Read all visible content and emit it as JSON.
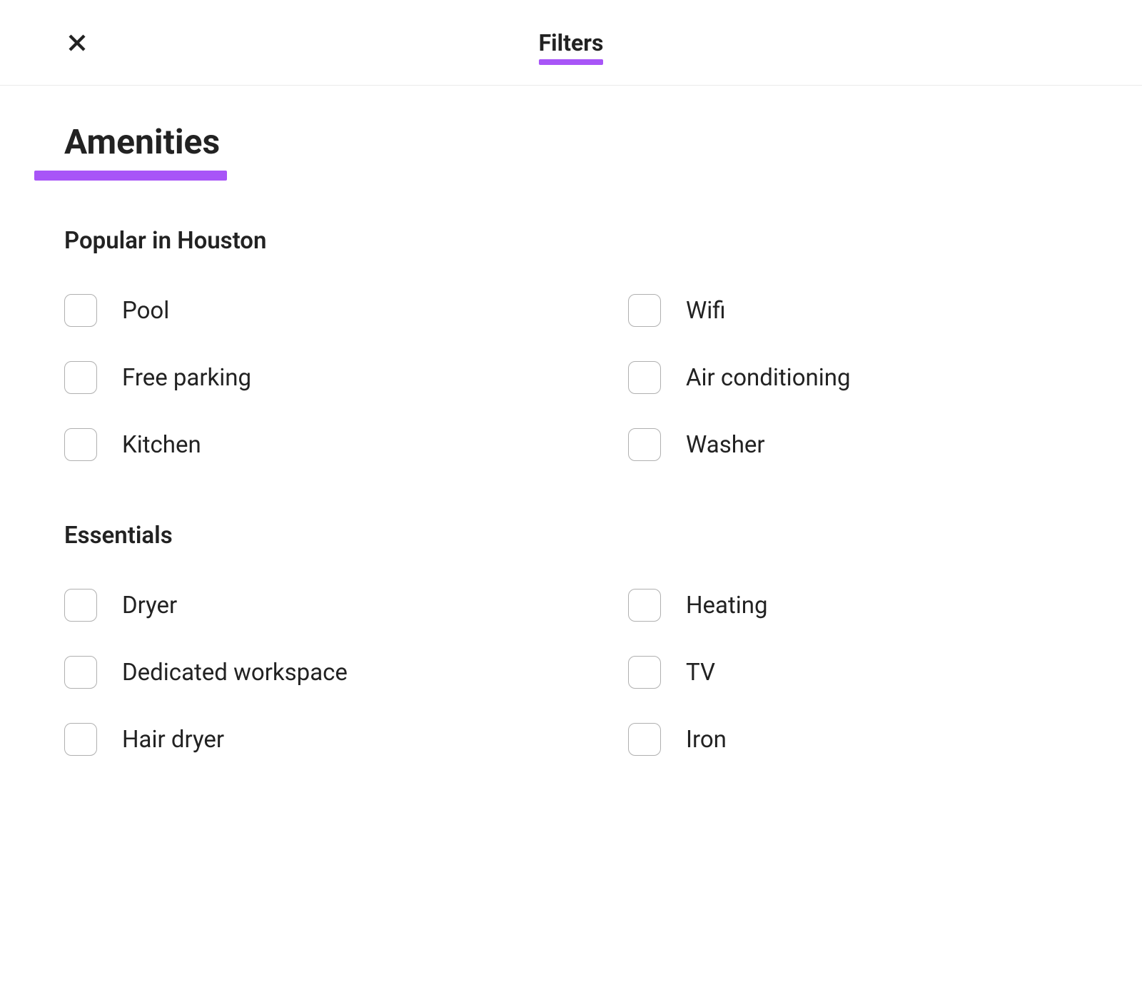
{
  "header": {
    "title": "Filters"
  },
  "section": {
    "title": "Amenities"
  },
  "subsections": [
    {
      "title": "Popular in Houston",
      "items": [
        {
          "label": "Pool"
        },
        {
          "label": "Wifi"
        },
        {
          "label": "Free parking"
        },
        {
          "label": "Air conditioning"
        },
        {
          "label": "Kitchen"
        },
        {
          "label": "Washer"
        }
      ]
    },
    {
      "title": "Essentials",
      "items": [
        {
          "label": "Dryer"
        },
        {
          "label": "Heating"
        },
        {
          "label": "Dedicated workspace"
        },
        {
          "label": "TV"
        },
        {
          "label": "Hair dryer"
        },
        {
          "label": "Iron"
        }
      ]
    }
  ]
}
